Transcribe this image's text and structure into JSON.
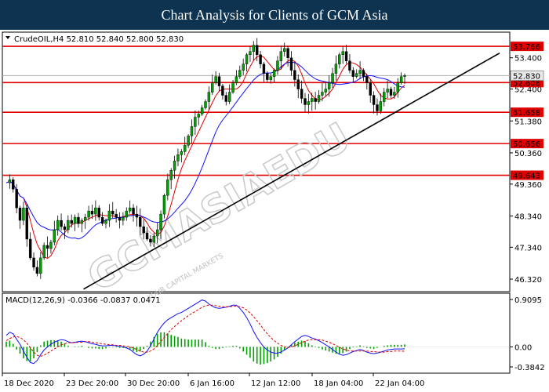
{
  "banner": {
    "title": "Chart Analysis for Clients of GCM Asia"
  },
  "watermark": {
    "brand": "GCMASIAEDU",
    "tagline": "YOUR CAPITAL MARKETS"
  },
  "chart_data": {
    "type": "candlestick",
    "symbol_line": "CrudeOIL,H4  52.810 52.840 52.800 52.830",
    "current_price": "52.830",
    "y_ticks": [
      "53.400",
      "52.400",
      "51.380",
      "50.360",
      "49.360",
      "48.340",
      "47.340",
      "46.320"
    ],
    "levels": [
      {
        "value": 53.766,
        "label": "53.766"
      },
      {
        "value": 52.608,
        "label": "52.608"
      },
      {
        "value": 51.658,
        "label": "51.658"
      },
      {
        "value": 50.656,
        "label": "50.656"
      },
      {
        "value": 49.643,
        "label": "49.643"
      }
    ],
    "x_ticks": [
      "18 Dec 2020",
      "23 Dec 20:00",
      "30 Dec 20:00",
      "6 Jan 16:00",
      "12 Jan 12:00",
      "18 Jan 04:00",
      "22 Jan 04:00"
    ],
    "trendline": {
      "from": [
        0.16,
        46.0
      ],
      "to": [
        0.98,
        53.55
      ]
    },
    "ohlc_path": [
      49.4,
      49.5,
      49.2,
      48.6,
      48.2,
      48.6,
      47.6,
      47.0,
      46.7,
      46.5,
      47.0,
      47.4,
      47.3,
      47.5,
      47.9,
      48.2,
      48.0,
      47.9,
      48.2,
      48.1,
      48.3,
      48.1,
      48.2,
      48.3,
      48.5,
      48.4,
      48.6,
      48.3,
      48.1,
      48.2,
      48.5,
      48.4,
      48.3,
      48.2,
      48.3,
      48.5,
      48.6,
      48.4,
      48.3,
      48.0,
      47.8,
      47.6,
      47.5,
      47.7,
      47.9,
      48.4,
      49.0,
      49.5,
      49.8,
      50.1,
      50.3,
      50.4,
      50.6,
      50.9,
      51.2,
      51.5,
      51.6,
      51.8,
      52.0,
      52.3,
      52.6,
      52.8,
      52.5,
      52.2,
      52.0,
      52.3,
      52.6,
      52.8,
      53.0,
      53.2,
      53.5,
      53.6,
      53.8,
      53.5,
      53.2,
      52.9,
      52.7,
      52.8,
      53.0,
      53.3,
      53.6,
      53.7,
      53.4,
      53.0,
      52.7,
      52.4,
      52.1,
      51.9,
      52.0,
      52.1,
      52.0,
      52.2,
      52.3,
      52.4,
      52.6,
      52.9,
      53.2,
      53.5,
      53.6,
      53.3,
      53.0,
      52.8,
      52.9,
      53.0,
      52.8,
      52.6,
      52.2,
      51.9,
      51.7,
      52.0,
      52.3,
      52.4,
      52.2,
      52.3,
      52.6,
      52.8,
      52.83
    ],
    "ma_fast_color": "#e00000",
    "ma_slow_color": "#1010ff",
    "candle_up_color": "#00a000",
    "candle_down_color": "#000000",
    "level_color": "#e00000",
    "macd": {
      "label": "MACD(12,26,9) -0.0366 -0.0837 0.0471",
      "y_ticks": [
        "0.9095",
        "0.00",
        "-0.3842"
      ],
      "ymax": 0.9095,
      "ymin": -0.3842,
      "macd_line": [
        0.22,
        0.28,
        0.25,
        0.15,
        0.05,
        -0.08,
        -0.2,
        -0.3,
        -0.32,
        -0.26,
        -0.15,
        -0.06,
        0.0,
        0.05,
        0.09,
        0.12,
        0.14,
        0.13,
        0.1,
        0.08,
        0.09,
        0.1,
        0.11,
        0.1,
        0.08,
        0.06,
        0.05,
        0.03,
        0.02,
        0.02,
        0.03,
        0.03,
        0.02,
        0.01,
        0.0,
        -0.02,
        -0.05,
        -0.1,
        -0.15,
        -0.17,
        -0.14,
        -0.08,
        0.02,
        0.15,
        0.28,
        0.38,
        0.46,
        0.52,
        0.56,
        0.6,
        0.64,
        0.66,
        0.7,
        0.74,
        0.78,
        0.82,
        0.86,
        0.9,
        0.88,
        0.82,
        0.78,
        0.75,
        0.74,
        0.75,
        0.76,
        0.78,
        0.8,
        0.8,
        0.74,
        0.66,
        0.56,
        0.44,
        0.3,
        0.18,
        0.08,
        0.0,
        -0.06,
        -0.1,
        -0.12,
        -0.12,
        -0.1,
        -0.06,
        -0.02,
        0.04,
        0.1,
        0.15,
        0.2,
        0.22,
        0.2,
        0.17,
        0.15,
        0.12,
        0.08,
        0.04,
        0.0,
        -0.05,
        -0.1,
        -0.14,
        -0.16,
        -0.15,
        -0.12,
        -0.09,
        -0.07,
        -0.05,
        -0.07,
        -0.1,
        -0.12,
        -0.13,
        -0.12,
        -0.1,
        -0.08,
        -0.06,
        -0.05,
        -0.04,
        -0.04,
        -0.04,
        -0.037
      ],
      "signal_line": [
        0.12,
        0.16,
        0.19,
        0.2,
        0.18,
        0.14,
        0.07,
        -0.02,
        -0.1,
        -0.16,
        -0.18,
        -0.16,
        -0.12,
        -0.08,
        -0.04,
        0.0,
        0.04,
        0.06,
        0.08,
        0.08,
        0.08,
        0.09,
        0.09,
        0.1,
        0.1,
        0.09,
        0.08,
        0.07,
        0.06,
        0.05,
        0.04,
        0.04,
        0.03,
        0.03,
        0.02,
        0.01,
        0.0,
        -0.02,
        -0.05,
        -0.08,
        -0.1,
        -0.1,
        -0.08,
        -0.04,
        0.03,
        0.1,
        0.18,
        0.26,
        0.33,
        0.39,
        0.45,
        0.5,
        0.55,
        0.6,
        0.64,
        0.68,
        0.72,
        0.76,
        0.79,
        0.8,
        0.8,
        0.79,
        0.78,
        0.77,
        0.77,
        0.77,
        0.78,
        0.78,
        0.77,
        0.75,
        0.71,
        0.65,
        0.58,
        0.5,
        0.42,
        0.33,
        0.25,
        0.18,
        0.12,
        0.07,
        0.03,
        0.0,
        -0.01,
        0.0,
        0.02,
        0.05,
        0.08,
        0.11,
        0.13,
        0.14,
        0.14,
        0.14,
        0.13,
        0.11,
        0.09,
        0.06,
        0.03,
        -0.01,
        -0.04,
        -0.06,
        -0.08,
        -0.08,
        -0.08,
        -0.08,
        -0.08,
        -0.08,
        -0.09,
        -0.09,
        -0.1,
        -0.1,
        -0.1,
        -0.09,
        -0.09,
        -0.08,
        -0.08,
        -0.08,
        -0.084
      ]
    }
  }
}
